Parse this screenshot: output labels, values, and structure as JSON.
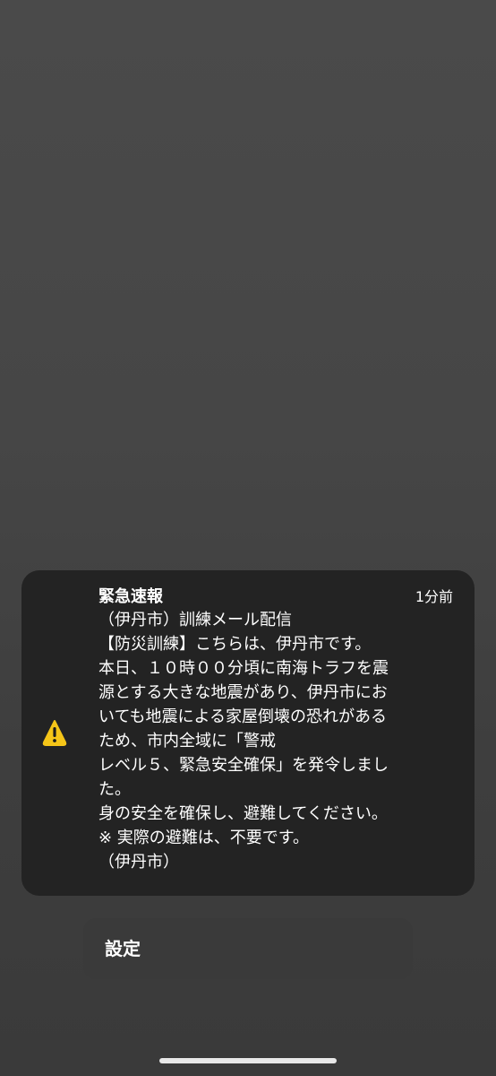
{
  "notification": {
    "title": "緊急速報",
    "time": "1分前",
    "icon": "warning-icon",
    "icon_color": "#f5c518",
    "body_lines": [
      "（伊丹市）訓練メール配信",
      "【防災訓練】こちらは、伊丹市です。",
      "本日、１０時００分頃に南海トラフを震",
      "源とする大きな地震があり、伊丹市にお",
      "いても地震による家屋倒壊の恐れがある",
      "ため、市内全域に「警戒",
      "レベル５、緊急安全確保」を発令しまし",
      "た。",
      "身の安全を確保し、避難してください。",
      "※ 実際の避難は、不要です。",
      "（伊丹市）"
    ]
  },
  "settings": {
    "label": "設定"
  }
}
